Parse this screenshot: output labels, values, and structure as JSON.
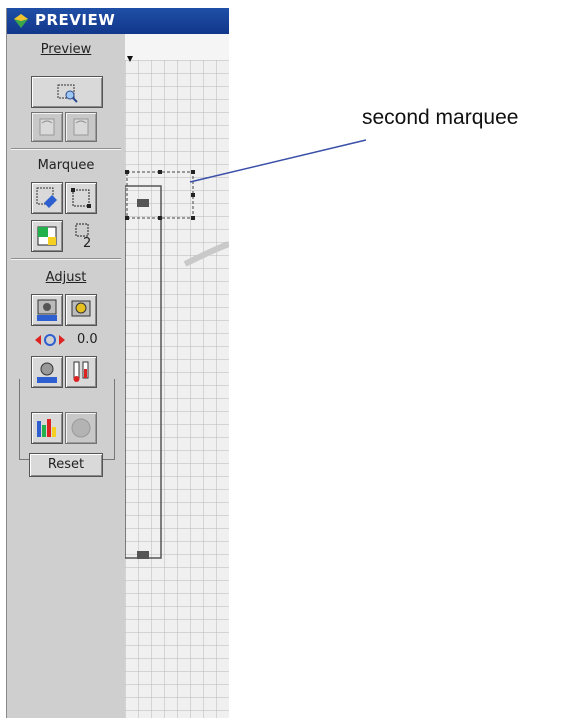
{
  "window": {
    "title": "PREVIEW"
  },
  "sections": {
    "preview": {
      "label": "Preview"
    },
    "marquee": {
      "label": "Marquee",
      "count": "2"
    },
    "adjust": {
      "label": "Adjust",
      "value": "0.0"
    }
  },
  "buttons": {
    "reset_label": "Reset"
  },
  "annotation": {
    "text": "second marquee"
  }
}
